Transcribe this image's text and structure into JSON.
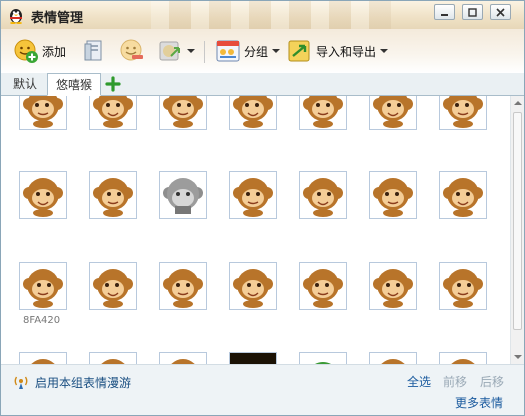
{
  "window": {
    "title": "表情管理",
    "controls": [
      "minimize",
      "maximize",
      "close"
    ]
  },
  "toolbar": {
    "add_label": "添加",
    "group_label": "分组",
    "import_export_label": "导入和导出",
    "icons": [
      "add-face-icon",
      "export-file-icon",
      "remove-face-icon",
      "move-icon",
      "group-icon",
      "import-export-icon"
    ]
  },
  "tabs": [
    {
      "label": "默认",
      "active": false
    },
    {
      "label": "悠嘻猴",
      "active": true
    }
  ],
  "grid": {
    "rows": [
      [
        "monkey-face",
        "monkey-face",
        "monkey-face",
        "monkey-face",
        "monkey-face",
        "monkey-face",
        "monkey-face"
      ],
      [
        "monkey-face",
        "monkey-face",
        "monkey-face-gray",
        "monkey-face",
        "monkey-face",
        "monkey-face",
        "monkey-face"
      ],
      [
        "monkey-face",
        "monkey-face",
        "monkey-face",
        "monkey-face",
        "monkey-face",
        "monkey-face",
        "monkey-face"
      ],
      [
        "monkey-face",
        "monkey-face",
        "monkey-face",
        "dark-image",
        "green-hat-face",
        "monkey-face",
        "monkey-face"
      ]
    ],
    "item_code": "8FA420"
  },
  "footer": {
    "roam_label": "启用本组表情漫游",
    "select_all": "全选",
    "move_prev": "前移",
    "move_next": "后移",
    "more": "更多表情"
  },
  "colors": {
    "monkey_brown": "#b8742a",
    "monkey_face": "#f4cd97",
    "cell_border": "#b8c9dd",
    "link_blue": "#1a5a9e",
    "disabled_link": "#9aa9b6"
  }
}
